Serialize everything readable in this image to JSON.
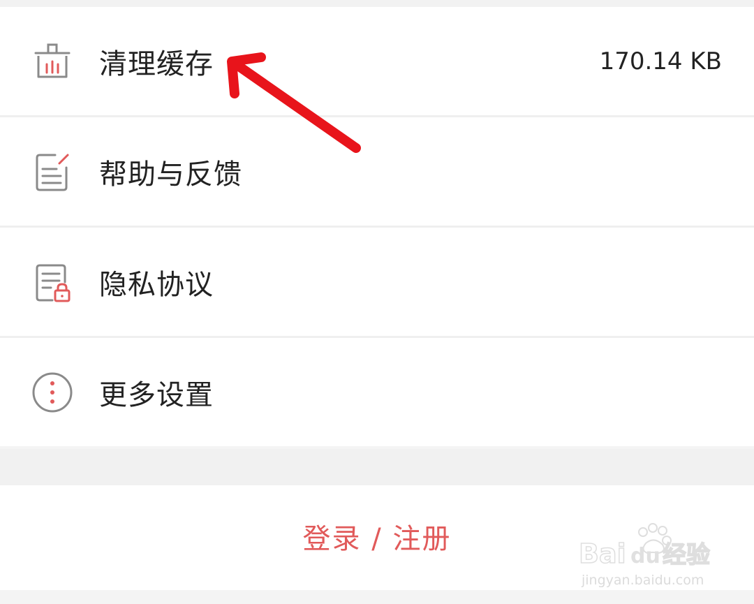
{
  "menu": {
    "items": [
      {
        "id": "clear-cache",
        "label": "清理缓存",
        "value": "170.14 KB",
        "icon": "broom-icon"
      },
      {
        "id": "help-feedback",
        "label": "帮助与反馈",
        "value": "",
        "icon": "feedback-edit-icon"
      },
      {
        "id": "privacy-policy",
        "label": "隐私协议",
        "value": "",
        "icon": "document-lock-icon"
      },
      {
        "id": "more-settings",
        "label": "更多设置",
        "value": "",
        "icon": "more-vertical-icon"
      }
    ]
  },
  "login": {
    "label": "登录 / 注册"
  },
  "annotation": {
    "arrow_color": "#e8141b"
  },
  "watermark": {
    "logo_text": "Baidu经验",
    "url_text": "jingyan.baidu.com"
  },
  "colors": {
    "accent_red": "#e15a5a",
    "icon_gray": "#8a8a8a",
    "text_dark": "#222222",
    "background": "#f4f4f4"
  }
}
